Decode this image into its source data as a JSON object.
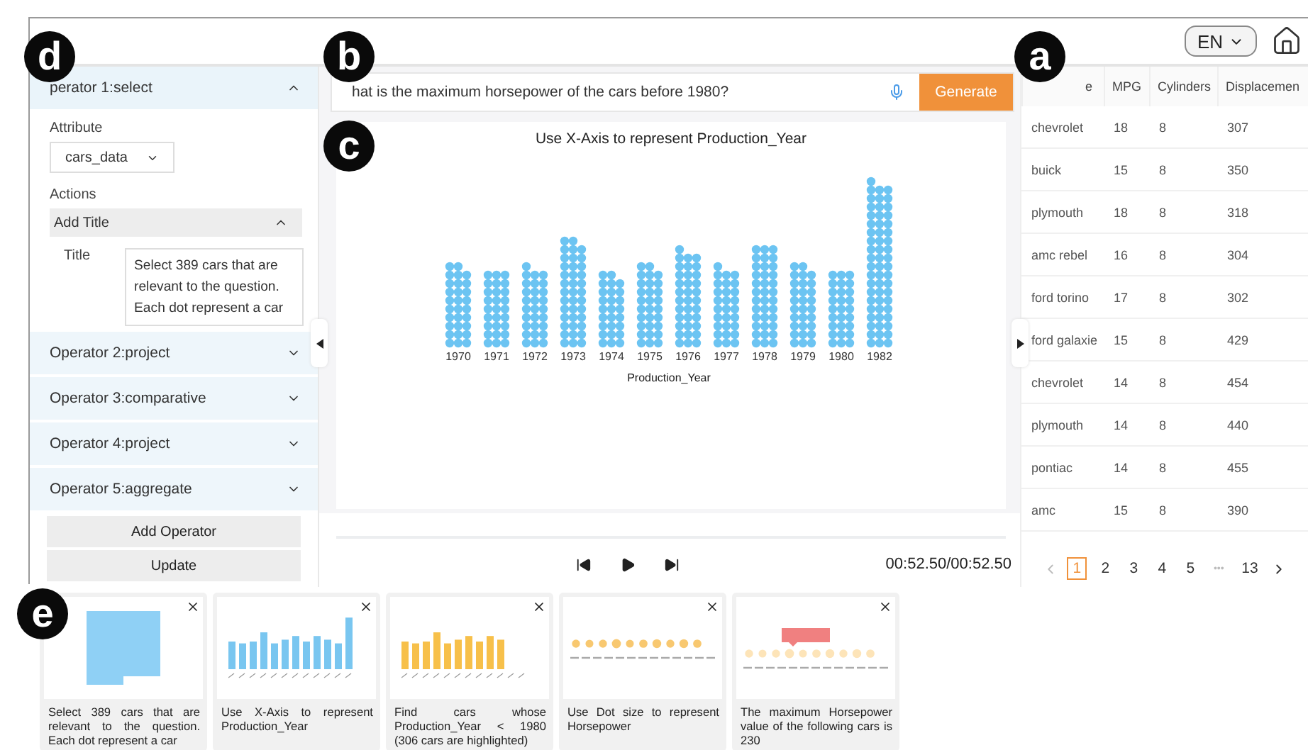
{
  "top_bar": {
    "language": "EN"
  },
  "operators": [
    {
      "title": "perator 1:select",
      "expanded": true,
      "attribute_label": "Attribute",
      "attribute_value": "cars_data",
      "actions_label": "Actions",
      "action": {
        "title": "Add Title",
        "expanded": true,
        "field_label": "Title",
        "field_value": "Select 389 cars that are relevant to the question. Each dot represent a car"
      }
    },
    {
      "title": "Operator 2:project",
      "expanded": false
    },
    {
      "title": "Operator 3:comparative",
      "expanded": false
    },
    {
      "title": "Operator 4:project",
      "expanded": false
    },
    {
      "title": "Operator 5:aggregate",
      "expanded": false
    }
  ],
  "panel_buttons": [
    "Add Operator",
    "Update"
  ],
  "question": {
    "value": "hat is the maximum horsepower of the cars before 1980?",
    "button": "Generate"
  },
  "chart": {
    "title": "Use X-Axis to represent Production_Year",
    "xlabel": "Production_Year",
    "x_labels": [
      "1970",
      "1971",
      "1972",
      "1973",
      "1974",
      "1975",
      "1976",
      "1977",
      "1978",
      "1979",
      "1980",
      "1982"
    ]
  },
  "player": {
    "time": "00:52.50/00:52.50"
  },
  "table": {
    "columns": [
      "e",
      "MPG",
      "Cylinders",
      "Displacemen"
    ],
    "rows": [
      [
        "chevrolet",
        "18",
        "8",
        "307"
      ],
      [
        "buick",
        "15",
        "8",
        "350"
      ],
      [
        "plymouth",
        "18",
        "8",
        "318"
      ],
      [
        "amc rebel",
        "16",
        "8",
        "304"
      ],
      [
        "ford torino",
        "17",
        "8",
        "302"
      ],
      [
        "ford galaxie",
        "15",
        "8",
        "429"
      ],
      [
        "chevrolet",
        "14",
        "8",
        "454"
      ],
      [
        "plymouth",
        "14",
        "8",
        "440"
      ],
      [
        "pontiac",
        "14",
        "8",
        "455"
      ],
      [
        "amc",
        "15",
        "8",
        "390"
      ]
    ]
  },
  "pagination": [
    {
      "label": "1",
      "kind": "page",
      "selected": true
    },
    {
      "label": "2",
      "kind": "page",
      "selected": false
    },
    {
      "label": "3",
      "kind": "page",
      "selected": false
    },
    {
      "label": "4",
      "kind": "page",
      "selected": false
    },
    {
      "label": "5",
      "kind": "page",
      "selected": false
    },
    {
      "label": "•••",
      "kind": "ellipsis",
      "selected": false
    },
    {
      "label": "13",
      "kind": "page",
      "selected": false
    }
  ],
  "steps": [
    {
      "kind": "grid",
      "caption": "Select 389 cars that are relevant to the question. Each dot represent a car"
    },
    {
      "kind": "bars",
      "caption": "Use X-Axis to represent Production_Year"
    },
    {
      "kind": "filtered-bars",
      "caption": "Find cars whose Production_Year < 1980 (306 cars are highlighted)"
    },
    {
      "kind": "dots",
      "caption": "Use Dot size to represent Horsepower"
    },
    {
      "kind": "annotated-dots",
      "caption": "The maximum Horsepower value of the following cars is 230"
    }
  ],
  "callouts": [
    "d",
    "b",
    "c",
    "a",
    "e"
  ]
}
